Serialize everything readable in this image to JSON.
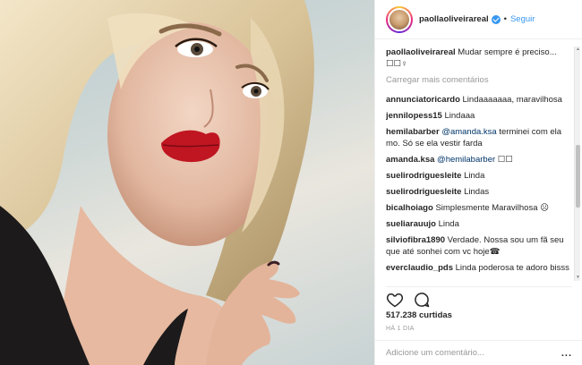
{
  "post": {
    "username": "paollaoliveirareal",
    "separator": "•",
    "follow_label": "Seguir",
    "likes": "517.238 curtidas",
    "date": "HÁ 1 DIA",
    "comment_placeholder": "Adicione um comentário...",
    "more_options": "..."
  },
  "caption": {
    "user": "paollaoliveirareal",
    "text": "Mudar sempre é preciso... ☐☐♀"
  },
  "load_more_label": "Carregar mais comentários",
  "comments": [
    {
      "user": "annunciatoricardo",
      "text": "Lindaaaaaaa, maravilhosa"
    },
    {
      "user": "jennilopess15",
      "text": "Lindaaa"
    },
    {
      "user": "hemilabarber",
      "mention": "@amanda.ksa",
      "text": "terminei com ela mo. Só se ela vestir farda"
    },
    {
      "user": "amanda.ksa",
      "mention": "@hemilabarber",
      "text": "☐☐"
    },
    {
      "user": "suelirodriguesleite",
      "text": "Linda"
    },
    {
      "user": "suelirodriguesleite",
      "text": "Lindas"
    },
    {
      "user": "bicalhoiago",
      "text": "Simplesmente Maravilhosa ☹"
    },
    {
      "user": "sueliarauujo",
      "text": "Linda"
    },
    {
      "user": "silviofibra1890",
      "text": "Verdade. Nossa sou um fã seu que até sonhei com vc hoje☎"
    },
    {
      "user": "everclaudio_pds",
      "text": "Linda poderosa te adoro bisss"
    }
  ],
  "icons": {
    "heart": "heart-icon",
    "comment": "comment-icon",
    "verified": "verified-badge-icon"
  },
  "colors": {
    "link": "#3897f0",
    "mention": "#003569",
    "muted": "#999999"
  }
}
